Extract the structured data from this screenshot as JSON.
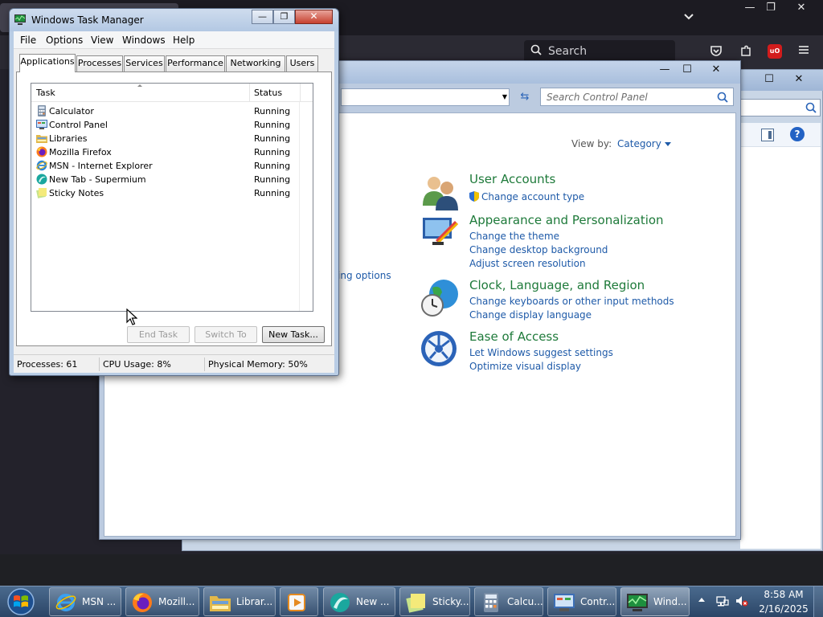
{
  "browser": {
    "search_label": "Search",
    "window_controls": {
      "minimize": "—",
      "restore": "❐",
      "close": "✕"
    }
  },
  "control_panel": {
    "search_placeholder": "Search Control Panel",
    "view_by_label": "View by:",
    "view_by_value": "Category",
    "partial_left_link": "ing options",
    "window_controls": {
      "minimize": "—",
      "maximize": "☐",
      "close": "✕"
    },
    "categories": [
      {
        "title": "User Accounts",
        "links": [
          "Change account type"
        ],
        "icon": "user-accounts-icon"
      },
      {
        "title": "Appearance and Personalization",
        "links": [
          "Change the theme",
          "Change desktop background",
          "Adjust screen resolution"
        ],
        "icon": "appearance-icon"
      },
      {
        "title": "Clock, Language, and Region",
        "links": [
          "Change keyboards or other input methods",
          "Change display language"
        ],
        "icon": "clock-globe-icon"
      },
      {
        "title": "Ease of Access",
        "links": [
          "Let Windows suggest settings",
          "Optimize visual display"
        ],
        "icon": "ease-of-access-icon"
      }
    ]
  },
  "task_manager": {
    "title": "Windows Task Manager",
    "window_controls": {
      "minimize": "—",
      "maximize": "❐",
      "close": "✕"
    },
    "menu": [
      "File",
      "Options",
      "View",
      "Windows",
      "Help"
    ],
    "tabs": [
      "Applications",
      "Processes",
      "Services",
      "Performance",
      "Networking",
      "Users"
    ],
    "active_tab": "Applications",
    "columns": {
      "task": "Task",
      "status": "Status"
    },
    "rows": [
      {
        "task": "Calculator",
        "status": "Running",
        "icon": "calculator-icon"
      },
      {
        "task": "Control Panel",
        "status": "Running",
        "icon": "control-panel-icon"
      },
      {
        "task": "Libraries",
        "status": "Running",
        "icon": "folder-icon"
      },
      {
        "task": "Mozilla Firefox",
        "status": "Running",
        "icon": "firefox-icon"
      },
      {
        "task": "MSN - Internet Explorer",
        "status": "Running",
        "icon": "ie-icon"
      },
      {
        "task": "New Tab - Supermium",
        "status": "Running",
        "icon": "supermium-icon"
      },
      {
        "task": "Sticky Notes",
        "status": "Running",
        "icon": "sticky-notes-icon"
      }
    ],
    "buttons": {
      "end_task": "End Task",
      "switch_to": "Switch To",
      "new_task": "New Task..."
    },
    "status": {
      "processes": "Processes: 61",
      "cpu": "CPU Usage: 8%",
      "memory": "Physical Memory: 50%"
    }
  },
  "taskbar": {
    "items": [
      {
        "label": "MSN ...",
        "icon": "ie-icon"
      },
      {
        "label": "Mozill...",
        "icon": "firefox-icon"
      },
      {
        "label": "Librar...",
        "icon": "folder-icon"
      },
      {
        "label": "",
        "icon": "media-player-icon"
      },
      {
        "label": "New ...",
        "icon": "supermium-icon"
      },
      {
        "label": "Sticky...",
        "icon": "sticky-notes-icon"
      },
      {
        "label": "Calcu...",
        "icon": "calculator-icon"
      },
      {
        "label": "Contr...",
        "icon": "control-panel-icon"
      },
      {
        "label": "Wind...",
        "icon": "task-manager-icon"
      }
    ],
    "clock": {
      "time": "8:58 AM",
      "date": "2/16/2025"
    }
  },
  "colors": {
    "link": "#1e5aa8",
    "category_title": "#1e7a3a",
    "browser_bg": "#2b2a33",
    "taskbar": "#2b4566"
  }
}
